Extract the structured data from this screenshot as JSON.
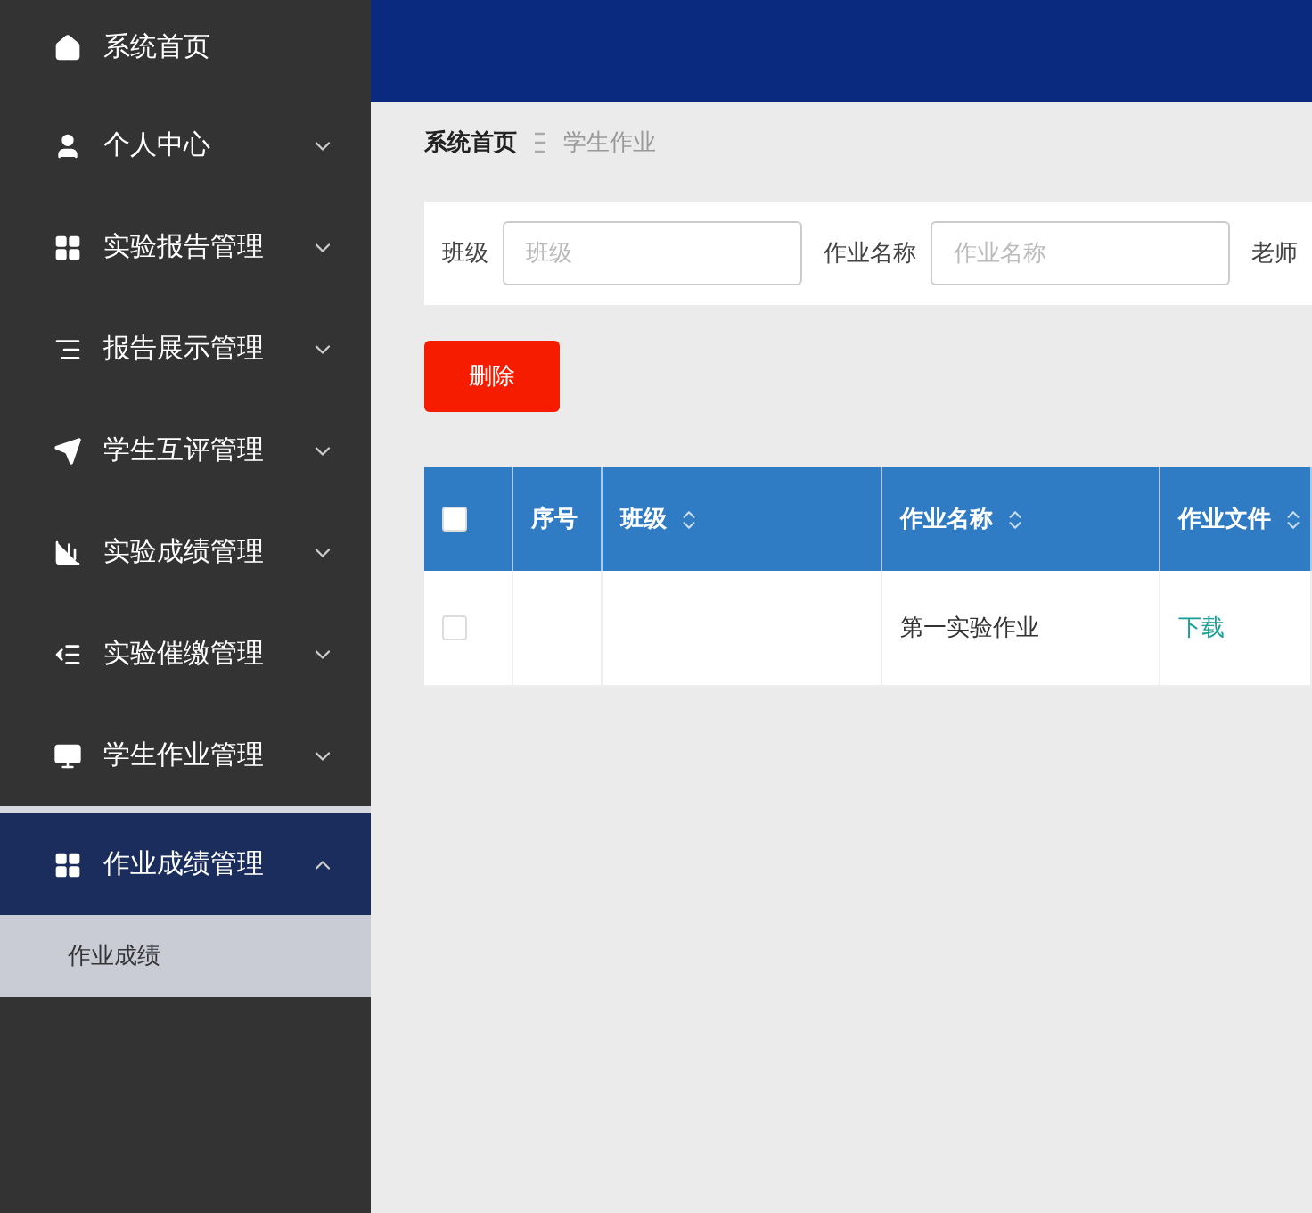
{
  "sidebar": {
    "items": [
      {
        "label": "系统首页"
      },
      {
        "label": "个人中心",
        "expanded": false
      },
      {
        "label": "实验报告管理",
        "expanded": false
      },
      {
        "label": "报告展示管理",
        "expanded": false
      },
      {
        "label": "学生互评管理",
        "expanded": false
      },
      {
        "label": "实验成绩管理",
        "expanded": false
      },
      {
        "label": "实验催缴管理",
        "expanded": false
      },
      {
        "label": "学生作业管理",
        "expanded": false
      },
      {
        "label": "作业成绩管理",
        "expanded": true,
        "children": [
          {
            "label": "作业成绩",
            "selected": true
          }
        ]
      }
    ]
  },
  "breadcrumb": [
    "系统首页",
    "学生作业"
  ],
  "search": {
    "fields": [
      {
        "label": "班级",
        "placeholder": "班级"
      },
      {
        "label": "作业名称",
        "placeholder": "作业名称"
      }
    ],
    "cut_label": "老师"
  },
  "delete_button": "删除",
  "table": {
    "header_checkbox": {
      "checked": false
    },
    "columns": [
      {
        "label": "序号",
        "sortable": false
      },
      {
        "label": "班级",
        "sortable": true
      },
      {
        "label": "作业名称",
        "sortable": true
      },
      {
        "label": "作业文件",
        "sortable": true
      }
    ],
    "rows": [
      {
        "checked": false,
        "cells": [
          "",
          "",
          "第一实验作业",
          "下载"
        ]
      }
    ]
  }
}
